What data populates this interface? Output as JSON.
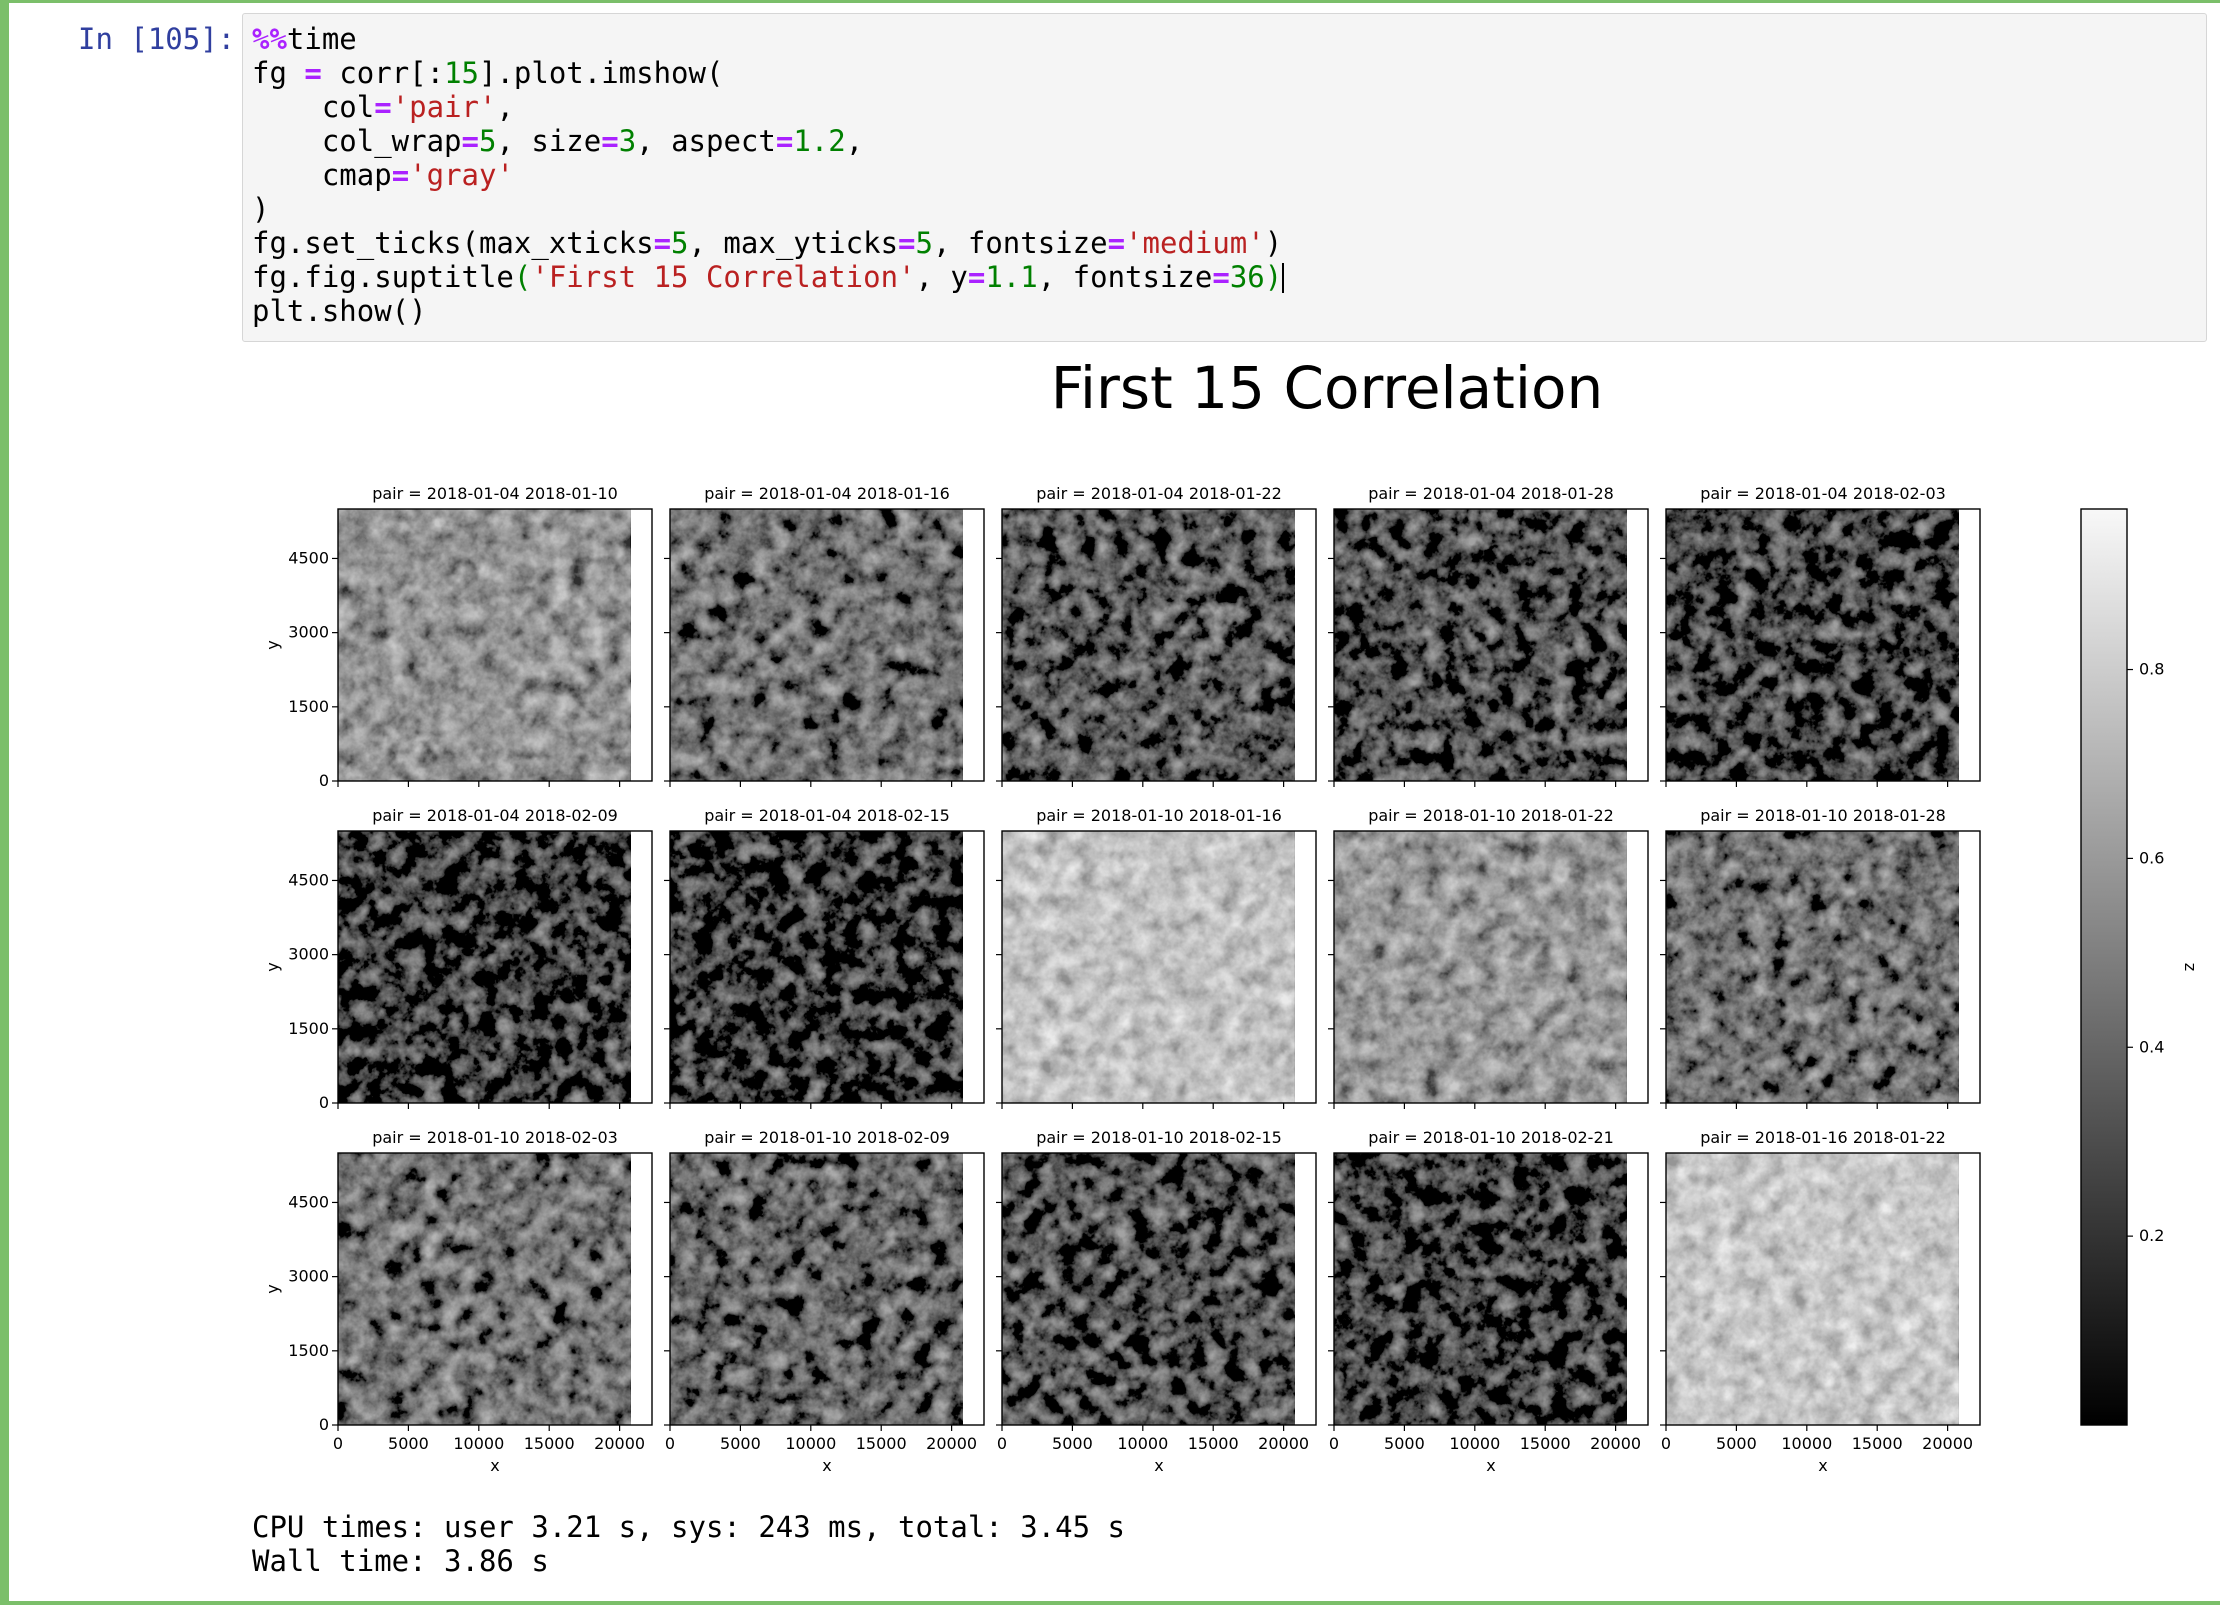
{
  "cell": {
    "prompt": "In [105]:",
    "code": [
      [
        {
          "t": "%%",
          "c": "k"
        },
        {
          "t": "time",
          "c": "p"
        }
      ],
      [
        {
          "t": "fg ",
          "c": "p"
        },
        {
          "t": "=",
          "c": "k"
        },
        {
          "t": " corr[:",
          "c": "p"
        },
        {
          "t": "15",
          "c": "n"
        },
        {
          "t": "].plot.imshow(",
          "c": "p"
        }
      ],
      [
        {
          "t": "    col",
          "c": "p"
        },
        {
          "t": "=",
          "c": "k"
        },
        {
          "t": "'pair'",
          "c": "s"
        },
        {
          "t": ",",
          "c": "p"
        }
      ],
      [
        {
          "t": "    col_wrap",
          "c": "p"
        },
        {
          "t": "=",
          "c": "k"
        },
        {
          "t": "5",
          "c": "n"
        },
        {
          "t": ", size",
          "c": "p"
        },
        {
          "t": "=",
          "c": "k"
        },
        {
          "t": "3",
          "c": "n"
        },
        {
          "t": ", aspect",
          "c": "p"
        },
        {
          "t": "=",
          "c": "k"
        },
        {
          "t": "1.2",
          "c": "n"
        },
        {
          "t": ",",
          "c": "p"
        }
      ],
      [
        {
          "t": "    cmap",
          "c": "p"
        },
        {
          "t": "=",
          "c": "k"
        },
        {
          "t": "'gray'",
          "c": "s"
        }
      ],
      [
        {
          "t": ")",
          "c": "p"
        }
      ],
      [
        {
          "t": "fg.set_ticks(max_xticks",
          "c": "p"
        },
        {
          "t": "=",
          "c": "k"
        },
        {
          "t": "5",
          "c": "n"
        },
        {
          "t": ", max_yticks",
          "c": "p"
        },
        {
          "t": "=",
          "c": "k"
        },
        {
          "t": "5",
          "c": "n"
        },
        {
          "t": ", fontsize",
          "c": "p"
        },
        {
          "t": "=",
          "c": "k"
        },
        {
          "t": "'medium'",
          "c": "s"
        },
        {
          "t": ")",
          "c": "p"
        }
      ],
      [
        {
          "t": "fg.fig.suptitle",
          "c": "p"
        },
        {
          "t": "(",
          "c": "n"
        },
        {
          "t": "'First 15 Correlation'",
          "c": "s"
        },
        {
          "t": ", y",
          "c": "p"
        },
        {
          "t": "=",
          "c": "k"
        },
        {
          "t": "1.1",
          "c": "n"
        },
        {
          "t": ", fontsize",
          "c": "p"
        },
        {
          "t": "=",
          "c": "k"
        },
        {
          "t": "36",
          "c": "n"
        },
        {
          "t": ")",
          "c": "n"
        }
      ],
      [
        {
          "t": "plt.show()",
          "c": "p"
        }
      ]
    ]
  },
  "output": {
    "cpu_line": "CPU times: user 3.21 s, sys: 243 ms, total: 3.45 s",
    "wall_line": "Wall time: 3.86 s"
  },
  "chart_data": {
    "type": "heatmap",
    "title": "First 15 Correlation",
    "cmap": "gray",
    "xlabel": "x",
    "ylabel": "y",
    "xticks": [
      0,
      5000,
      10000,
      15000,
      20000
    ],
    "yticks": [
      0,
      1500,
      3000,
      4500
    ],
    "xlim": [
      0,
      22300
    ],
    "ylim": [
      0,
      5500
    ],
    "image_xmax": 20800,
    "colorbar": {
      "label": "z",
      "ticks": [
        0.2,
        0.4,
        0.6,
        0.8
      ],
      "range": [
        0,
        0.97
      ]
    },
    "panels": [
      {
        "title": "pair = 2018-01-04 2018-01-10",
        "level": 0.58
      },
      {
        "title": "pair = 2018-01-04 2018-01-16",
        "level": 0.45
      },
      {
        "title": "pair = 2018-01-04 2018-01-22",
        "level": 0.36
      },
      {
        "title": "pair = 2018-01-04 2018-01-28",
        "level": 0.32
      },
      {
        "title": "pair = 2018-01-04 2018-02-03",
        "level": 0.29
      },
      {
        "title": "pair = 2018-01-04 2018-02-09",
        "level": 0.25
      },
      {
        "title": "pair = 2018-01-04 2018-02-15",
        "level": 0.24
      },
      {
        "title": "pair = 2018-01-10 2018-01-16",
        "level": 0.76
      },
      {
        "title": "pair = 2018-01-10 2018-01-22",
        "level": 0.6
      },
      {
        "title": "pair = 2018-01-10 2018-01-28",
        "level": 0.45
      },
      {
        "title": "pair = 2018-01-10 2018-02-03",
        "level": 0.46
      },
      {
        "title": "pair = 2018-01-10 2018-02-09",
        "level": 0.4
      },
      {
        "title": "pair = 2018-01-10 2018-02-15",
        "level": 0.33
      },
      {
        "title": "pair = 2018-01-10 2018-02-21",
        "level": 0.27
      },
      {
        "title": "pair = 2018-01-16 2018-01-22",
        "level": 0.78
      }
    ]
  }
}
